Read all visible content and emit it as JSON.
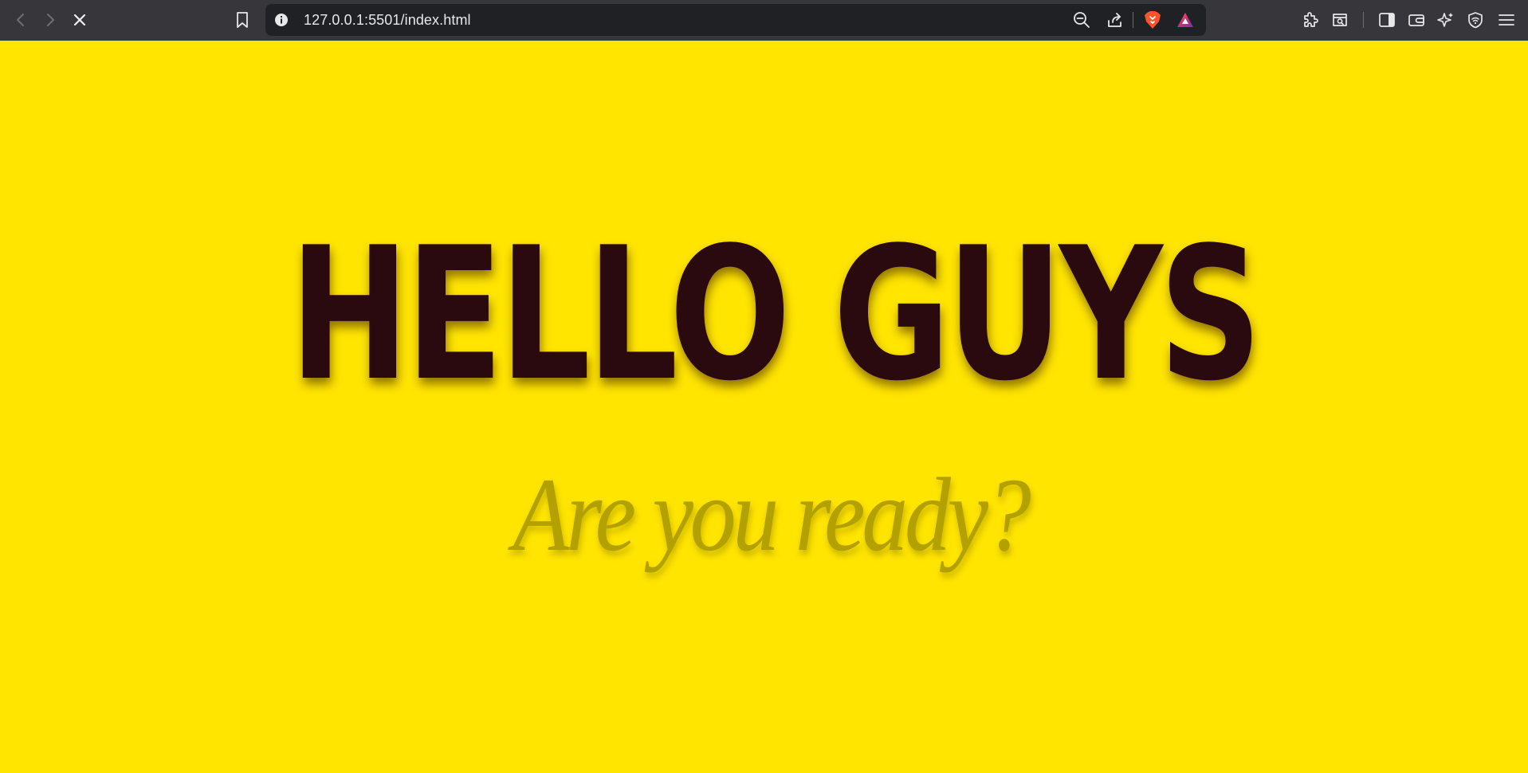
{
  "browser": {
    "url": "127.0.0.1:5501/index.html",
    "toolbar_bg": "#37373b",
    "urlbar_bg": "#202124",
    "icons": {
      "back": "arrow-left-icon",
      "forward": "arrow-right-icon",
      "stop": "close-icon",
      "bookmark": "bookmark-icon",
      "site_info": "info-icon",
      "zoom": "zoom-out-icon",
      "share": "share-icon",
      "brave_shields": "brave-lion-icon",
      "brave_rewards": "brave-rewards-triangle-icon",
      "extensions": "puzzle-icon",
      "search_tabs": "tab-search-icon",
      "sidebar": "sidebar-icon",
      "wallet": "wallet-icon",
      "leo": "sparkle-icon",
      "vpn": "vpn-shield-icon",
      "menu": "hamburger-menu-icon"
    }
  },
  "page": {
    "background": "#ffe500",
    "title": "HELLO GUYS",
    "subtitle": "Are you ready?",
    "title_color": "#2a0a0e",
    "subtitle_color": "#b3a100"
  }
}
